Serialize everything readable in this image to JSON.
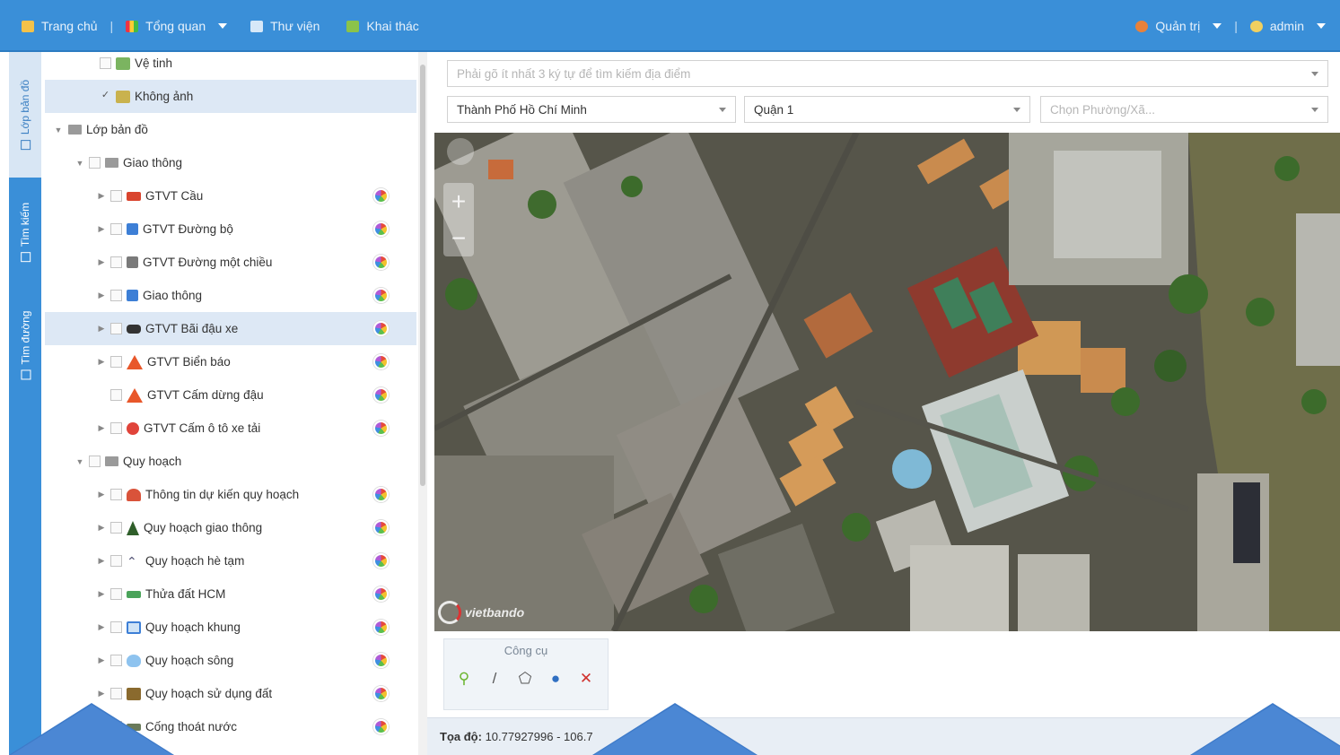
{
  "topbar": {
    "home": "Trang chủ",
    "overview": "Tổng quan",
    "library": "Thư viện",
    "exploit": "Khai thác",
    "admin_menu": "Quản trị",
    "user": "admin",
    "separator": "|"
  },
  "sidetabs": [
    "Lớp bản đồ",
    "Tìm kiếm",
    "Tìm đường"
  ],
  "tree": {
    "satellite": "Vệ tinh",
    "aerial": "Không ảnh",
    "map_layers": "Lớp bản đồ",
    "transport_group": "Giao thông",
    "planning_group": "Quy hoạch",
    "items": [
      "GTVT Cầu",
      "GTVT Đường bộ",
      "GTVT Đường một chiều",
      "Giao thông",
      "GTVT Bãi đậu xe",
      "GTVT Biển báo",
      "GTVT Cấm dừng đậu",
      "GTVT Cấm ô tô xe tải",
      "Thông tin dự kiến quy hoạch",
      "Quy hoạch giao thông",
      "Quy hoạch hè tạm",
      "Thửa đất HCM",
      "Quy hoạch khung",
      "Quy hoạch sông",
      "Quy hoạch sử dụng đất",
      "Cống thoát nước"
    ]
  },
  "search": {
    "placeholder": "Phải gõ ít nhất 3 ký tự để tìm kiếm địa điểm",
    "city": "Thành Phố Hồ Chí Minh",
    "district": "Quận 1",
    "ward_placeholder": "Chọn Phường/Xã..."
  },
  "map": {
    "logo": "vietbando",
    "zoom_in": "+",
    "zoom_out": "−"
  },
  "tools": {
    "title": "Công cụ"
  },
  "status": {
    "coord_label": "Tọa độ:",
    "coord_value": "10.77927996 - 106.7"
  },
  "colors": {
    "topbar": "#3a8fd8",
    "selected_row": "#dde8f5",
    "overlay_triangle": "#4b87d4"
  }
}
